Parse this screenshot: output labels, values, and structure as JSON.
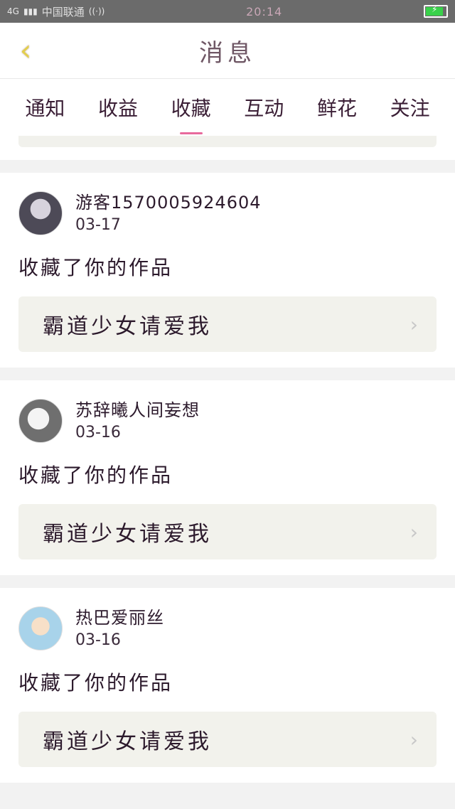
{
  "status_bar": {
    "network": "4G",
    "carrier": "中国联通",
    "time": "20:14"
  },
  "header": {
    "title": "消息"
  },
  "tabs": [
    {
      "label": "通知"
    },
    {
      "label": "收益"
    },
    {
      "label": "收藏",
      "active": true
    },
    {
      "label": "互动"
    },
    {
      "label": "鲜花"
    },
    {
      "label": "关注"
    }
  ],
  "items": [
    {
      "username": "游客1570005924604",
      "date": "03-17",
      "action": "收藏了你的作品",
      "work_title": "霸道少女请爱我"
    },
    {
      "username": "苏辞曦人间妄想",
      "date": "03-16",
      "action": "收藏了你的作品",
      "work_title": "霸道少女请爱我"
    },
    {
      "username": "热巴爱丽丝",
      "date": "03-16",
      "action": "收藏了你的作品",
      "work_title": "霸道少女请爱我"
    }
  ],
  "colors": {
    "accent": "#e86a9c",
    "back_icon": "#e2cf4d"
  }
}
